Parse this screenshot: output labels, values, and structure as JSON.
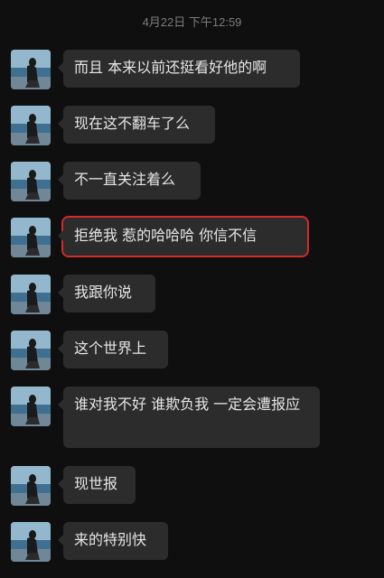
{
  "timestamp": "4月22日 下午12:59",
  "messages": [
    {
      "text": "而且 本来以前还挺看好他的啊",
      "highlighted": false
    },
    {
      "text": "现在这不翻车了么",
      "highlighted": false
    },
    {
      "text": "不一直关注着么",
      "highlighted": false
    },
    {
      "text": "拒绝我 惹的哈哈哈 你信不信",
      "highlighted": true
    },
    {
      "text": "我跟你说",
      "highlighted": false
    },
    {
      "text": "这个世界上",
      "highlighted": false
    },
    {
      "text": "谁对我不好 谁欺负我 一定会遭报应",
      "highlighted": false
    },
    {
      "text": "现世报",
      "highlighted": false
    },
    {
      "text": "来的特别快",
      "highlighted": false
    }
  ],
  "colors": {
    "background": "#0f0f0f",
    "bubble": "#2c2c2c",
    "highlight_box": "#d12b2b",
    "timestamp": "#7d7d7d"
  },
  "avatar_icon": "contact-avatar"
}
